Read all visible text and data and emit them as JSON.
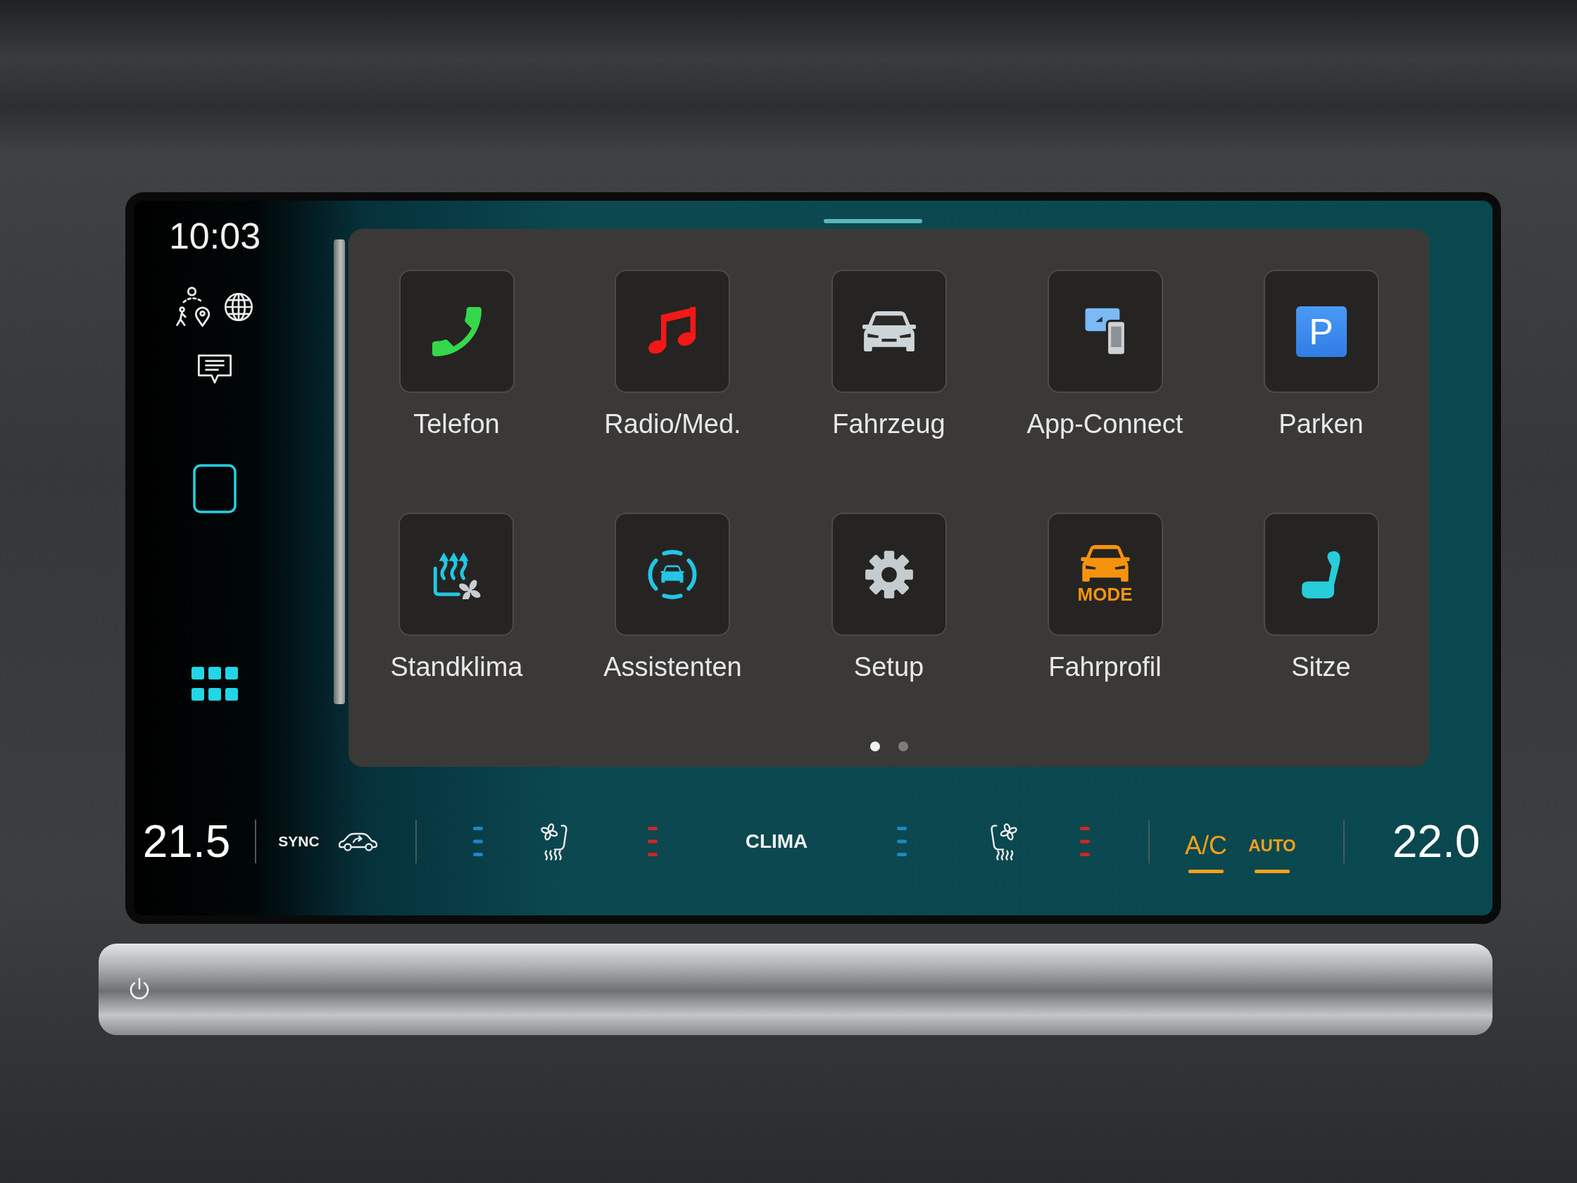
{
  "sidebar": {
    "time": "10:03"
  },
  "apps": [
    {
      "kind": "phone",
      "label": "Telefon"
    },
    {
      "kind": "media",
      "label": "Radio/Med."
    },
    {
      "kind": "vehicle",
      "label": "Fahrzeug"
    },
    {
      "kind": "connect",
      "label": "App-Connect"
    },
    {
      "kind": "parking",
      "label": "Parken",
      "icon_text": "P"
    },
    {
      "kind": "climate",
      "label": "Standklima"
    },
    {
      "kind": "assist",
      "label": "Assistenten"
    },
    {
      "kind": "setup",
      "label": "Setup"
    },
    {
      "kind": "profile",
      "label": "Fahrprofil",
      "icon_text": "MODE"
    },
    {
      "kind": "seats",
      "label": "Sitze"
    }
  ],
  "pages": [
    {
      "selected": true
    },
    {
      "selected": false
    }
  ],
  "climate": {
    "driver_temp": "21.5",
    "sync": "SYNC",
    "clima": "CLIMA",
    "toggles": [
      {
        "label": "A/C",
        "on": true
      },
      {
        "label": "AUTO",
        "on": true
      }
    ],
    "passenger_temp": "22.0"
  }
}
